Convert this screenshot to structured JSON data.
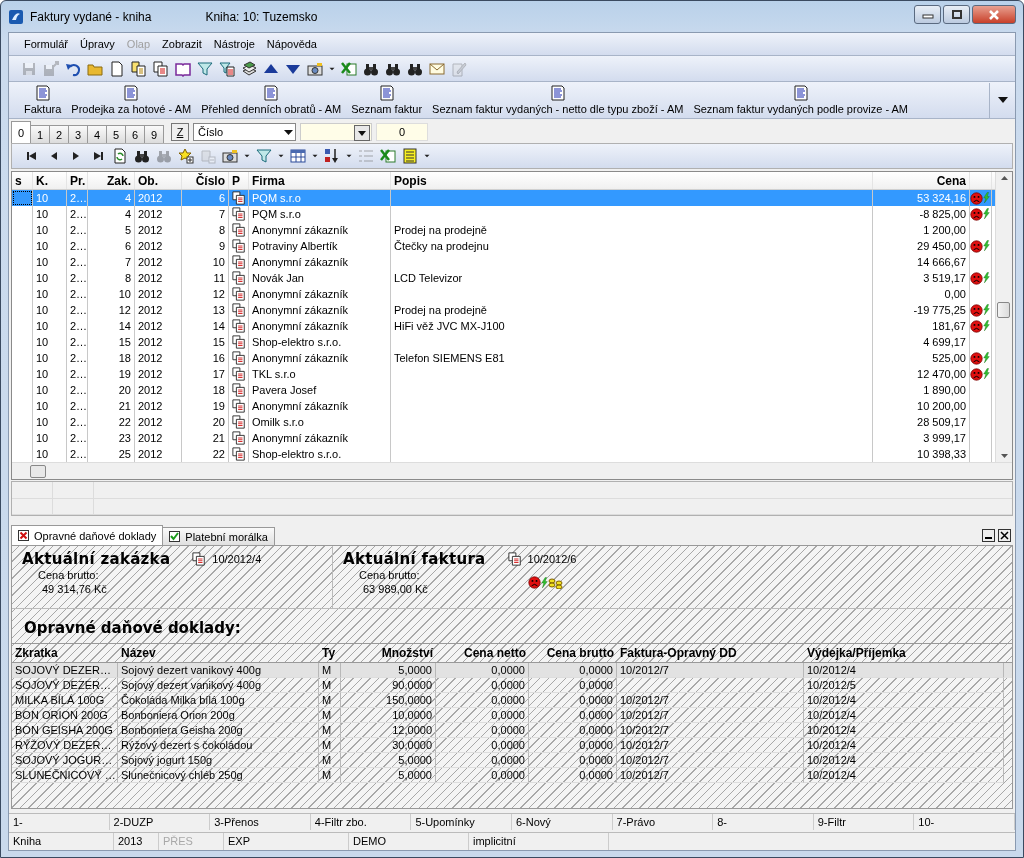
{
  "window": {
    "title": "Faktury vydané - kniha",
    "subtitle": "Kniha: 10: Tuzemsko"
  },
  "menu": [
    {
      "label": "Formulář",
      "disabled": false
    },
    {
      "label": "Úpravy",
      "disabled": false
    },
    {
      "label": "Olap",
      "disabled": true
    },
    {
      "label": "Zobrazit",
      "disabled": false
    },
    {
      "label": "Nástroje",
      "disabled": false
    },
    {
      "label": "Nápověda",
      "disabled": false
    }
  ],
  "toolbar": [
    {
      "kind": "save",
      "disabled": true
    },
    {
      "kind": "export",
      "disabled": true
    },
    {
      "kind": "undo",
      "disabled": false
    },
    {
      "kind": "folder",
      "disabled": false
    },
    {
      "kind": "doc",
      "disabled": false
    },
    {
      "kind": "copy",
      "disabled": false
    },
    {
      "kind": "docred",
      "disabled": false
    },
    {
      "kind": "book",
      "disabled": false
    },
    {
      "kind": "filter",
      "disabled": false
    },
    {
      "kind": "filterdoc",
      "disabled": false
    },
    {
      "kind": "stack",
      "disabled": false
    },
    {
      "kind": "up",
      "disabled": false
    },
    {
      "kind": "down",
      "disabled": false
    },
    {
      "kind": "camera",
      "disabled": false
    },
    {
      "kind": "caret",
      "disabled": false
    },
    {
      "kind": "excel",
      "disabled": false
    },
    {
      "kind": "binoculars",
      "disabled": false
    },
    {
      "kind": "binoculars",
      "disabled": false
    },
    {
      "kind": "binoculars",
      "disabled": false
    },
    {
      "kind": "mail",
      "disabled": false
    },
    {
      "kind": "edit",
      "disabled": true
    }
  ],
  "reports": [
    "Faktura",
    "Prodejka za hotové - AM",
    "Přehled denních obratů - AM",
    "Seznam faktur",
    "Seznam faktur vydaných - netto dle typu zboží - AM",
    "Seznam faktur vydaných podle provize - AM"
  ],
  "page_tabs": [
    {
      "label": "0",
      "selected": true
    },
    {
      "label": "1",
      "selected": false
    },
    {
      "label": "2",
      "selected": false
    },
    {
      "label": "3",
      "selected": false
    },
    {
      "label": "4",
      "selected": false
    },
    {
      "label": "5",
      "selected": false
    },
    {
      "label": "6",
      "selected": false
    },
    {
      "label": "9",
      "selected": false
    }
  ],
  "filter": {
    "z_button": "Z",
    "sort_field": "Číslo",
    "number_field": "0"
  },
  "nav_toolbar": [
    {
      "kind": "first",
      "disabled": false
    },
    {
      "kind": "prev",
      "disabled": false
    },
    {
      "kind": "next",
      "disabled": false
    },
    {
      "kind": "last",
      "disabled": false
    },
    {
      "kind": "refresh",
      "disabled": false
    },
    {
      "kind": "binoculars",
      "disabled": false
    },
    {
      "kind": "binoculars",
      "disabled": true
    },
    {
      "kind": "star",
      "disabled": false
    },
    {
      "kind": "delete",
      "disabled": true
    },
    {
      "kind": "camera",
      "disabled": false
    },
    {
      "kind": "caret",
      "disabled": false
    },
    {
      "kind": "filter",
      "disabled": false
    },
    {
      "kind": "caret",
      "disabled": false
    },
    {
      "kind": "columns",
      "disabled": false
    },
    {
      "kind": "caret",
      "disabled": false
    },
    {
      "kind": "sort",
      "disabled": false
    },
    {
      "kind": "caret",
      "disabled": false
    },
    {
      "kind": "list",
      "disabled": true
    },
    {
      "kind": "excel",
      "disabled": false
    },
    {
      "kind": "sheet",
      "disabled": false
    },
    {
      "kind": "caret",
      "disabled": false
    }
  ],
  "table": {
    "columns": [
      "s",
      "K.",
      "Pr.",
      "Zak.",
      "Ob.",
      "Číslo",
      "P",
      "Firma",
      "Popis",
      "Cena"
    ],
    "rows": [
      {
        "k": "10",
        "pr": "2…",
        "zak": "4",
        "ob": "2012",
        "cislo": "6",
        "firma": "PQM s.r.o",
        "cena": "53 324,16",
        "flagged": true,
        "selected": true
      },
      {
        "k": "10",
        "pr": "2…",
        "zak": "4",
        "ob": "2012",
        "cislo": "7",
        "firma": "PQM s.r.o",
        "cena": "-8 825,00",
        "flagged": true,
        "selected": false
      },
      {
        "k": "10",
        "pr": "2…",
        "zak": "5",
        "ob": "2012",
        "cislo": "8",
        "firma": "Anonymní zákazník",
        "popis": "Prodej na prodejně",
        "cena": "1 200,00",
        "flagged": false,
        "selected": false
      },
      {
        "k": "10",
        "pr": "2…",
        "zak": "6",
        "ob": "2012",
        "cislo": "9",
        "firma": "Potraviny Albertík",
        "popis": "Čtečky na prodejnu",
        "cena": "29 450,00",
        "flagged": true,
        "selected": false
      },
      {
        "k": "10",
        "pr": "2…",
        "zak": "7",
        "ob": "2012",
        "cislo": "10",
        "firma": "Anonymní zákazník",
        "cena": "14 666,67",
        "flagged": false,
        "selected": false
      },
      {
        "k": "10",
        "pr": "2…",
        "zak": "8",
        "ob": "2012",
        "cislo": "11",
        "firma": "Novák Jan",
        "popis": "LCD Televizor",
        "cena": "3 519,17",
        "flagged": true,
        "selected": false
      },
      {
        "k": "10",
        "pr": "2…",
        "zak": "10",
        "ob": "2012",
        "cislo": "12",
        "firma": "Anonymní zákazník",
        "cena": "0,00",
        "flagged": false,
        "selected": false
      },
      {
        "k": "10",
        "pr": "2…",
        "zak": "12",
        "ob": "2012",
        "cislo": "13",
        "firma": "Anonymní zákazník",
        "popis": "Prodej na prodejně",
        "cena": "-19 775,25",
        "flagged": true,
        "selected": false
      },
      {
        "k": "10",
        "pr": "2…",
        "zak": "14",
        "ob": "2012",
        "cislo": "14",
        "firma": "Anonymní zákazník",
        "popis": "HiFi věž JVC MX-J100",
        "cena": "181,67",
        "flagged": true,
        "selected": false
      },
      {
        "k": "10",
        "pr": "2…",
        "zak": "15",
        "ob": "2012",
        "cislo": "15",
        "firma": "Shop-elektro s.r.o.",
        "cena": "4 699,17",
        "flagged": false,
        "selected": false
      },
      {
        "k": "10",
        "pr": "2…",
        "zak": "18",
        "ob": "2012",
        "cislo": "16",
        "firma": "Anonymní zákazník",
        "popis": "Telefon SIEMENS E81",
        "cena": "525,00",
        "flagged": true,
        "selected": false
      },
      {
        "k": "10",
        "pr": "2…",
        "zak": "19",
        "ob": "2012",
        "cislo": "17",
        "firma": "TKL s.r.o",
        "cena": "12 470,00",
        "flagged": true,
        "selected": false
      },
      {
        "k": "10",
        "pr": "2…",
        "zak": "20",
        "ob": "2012",
        "cislo": "18",
        "firma": "Pavera Josef",
        "cena": "1 890,00",
        "flagged": false,
        "selected": false
      },
      {
        "k": "10",
        "pr": "2…",
        "zak": "21",
        "ob": "2012",
        "cislo": "19",
        "firma": "Anonymní zákazník",
        "cena": "10 200,00",
        "flagged": false,
        "selected": false
      },
      {
        "k": "10",
        "pr": "2…",
        "zak": "22",
        "ob": "2012",
        "cislo": "20",
        "firma": "Omilk s.r.o",
        "cena": "28 509,17",
        "flagged": false,
        "selected": false
      },
      {
        "k": "10",
        "pr": "2…",
        "zak": "23",
        "ob": "2012",
        "cislo": "21",
        "firma": "Anonymní zákazník",
        "cena": "3 999,17",
        "flagged": false,
        "selected": false
      },
      {
        "k": "10",
        "pr": "2…",
        "zak": "25",
        "ob": "2012",
        "cislo": "22",
        "firma": "Shop-elektro s.r.o.",
        "cena": "10 398,33",
        "flagged": false,
        "selected": false
      }
    ]
  },
  "panel_tabs": [
    {
      "label": "Opravné daňové doklady",
      "checked": false,
      "selected": true
    },
    {
      "label": "Platební morálka",
      "checked": true,
      "selected": false
    }
  ],
  "current_order": {
    "title": "Aktuální zakázka",
    "number": "10/2012/4",
    "price_label": "Cena brutto:",
    "price": "49 314,76 Kč"
  },
  "current_invoice": {
    "title": "Aktuální faktura",
    "number": "10/2012/6",
    "price_label": "Cena brutto:",
    "price": "63 989,00 Kč"
  },
  "corrections": {
    "title": "Opravné daňové doklady:",
    "columns": [
      "Zkratka",
      "Název",
      "Ty",
      "Množství",
      "Cena netto",
      "Cena brutto",
      "Faktura-Opravný DD",
      "Výdejka/Příjemka"
    ],
    "rows": [
      {
        "cells": [
          "SOJOVÝ DEZER…",
          "Sojový dezert vanikový 400g",
          "M",
          "5,0000",
          "0,0000",
          "0,0000",
          "10/2012/7",
          "10/2012/4"
        ],
        "selected": true
      },
      {
        "cells": [
          "SOJOVÝ DEZER…",
          "Sojový dezert vanikový 400g",
          "M",
          "90,0000",
          "0,0000",
          "0,0000",
          "",
          "10/2012/5"
        ],
        "selected": false
      },
      {
        "cells": [
          "MILKA BÍLÁ 100G",
          "Čokoláda Milka bílá 100g",
          "M",
          "150,0000",
          "0,0000",
          "0,0000",
          "10/2012/7",
          "10/2012/4"
        ],
        "selected": false
      },
      {
        "cells": [
          "BON ORION 200G",
          "Bonboniera Orion 200g",
          "M",
          "10,0000",
          "0,0000",
          "0,0000",
          "10/2012/7",
          "10/2012/4"
        ],
        "selected": false
      },
      {
        "cells": [
          "BON GEISHA 200G",
          "Bonboniera Geisha 200g",
          "M",
          "12,0000",
          "0,0000",
          "0,0000",
          "10/2012/7",
          "10/2012/4"
        ],
        "selected": false
      },
      {
        "cells": [
          "RÝŽOVÝ DEZER…",
          "Rýžový dezert s čokoládou",
          "M",
          "30,0000",
          "0,0000",
          "0,0000",
          "10/2012/7",
          "10/2012/4"
        ],
        "selected": false
      },
      {
        "cells": [
          "SOJOVÝ JOGUR…",
          "Sojový jogurt 150g",
          "M",
          "5,0000",
          "0,0000",
          "0,0000",
          "10/2012/7",
          "10/2012/4"
        ],
        "selected": false
      },
      {
        "cells": [
          "SLUNEČNICOVÝ …",
          "Slunečnicový chléb 250g",
          "M",
          "5,0000",
          "0,0000",
          "0,0000",
          "10/2012/7",
          "10/2012/4"
        ],
        "selected": false
      }
    ]
  },
  "function_keys": [
    "1-",
    "2-DUZP",
    "3-Přenos",
    "4-Filtr zbo.",
    "5-Upomínky",
    "6-Nový",
    "7-Právo",
    "8-",
    "9-Filtr",
    "10-"
  ],
  "status_bar": [
    {
      "text": "Kniha",
      "disabled": false
    },
    {
      "text": "2013",
      "disabled": false
    },
    {
      "text": "PŘES",
      "disabled": true
    },
    {
      "text": "EXP",
      "disabled": false
    },
    {
      "text": "DEMO",
      "disabled": false
    },
    {
      "text": "implicitní",
      "disabled": false
    }
  ]
}
